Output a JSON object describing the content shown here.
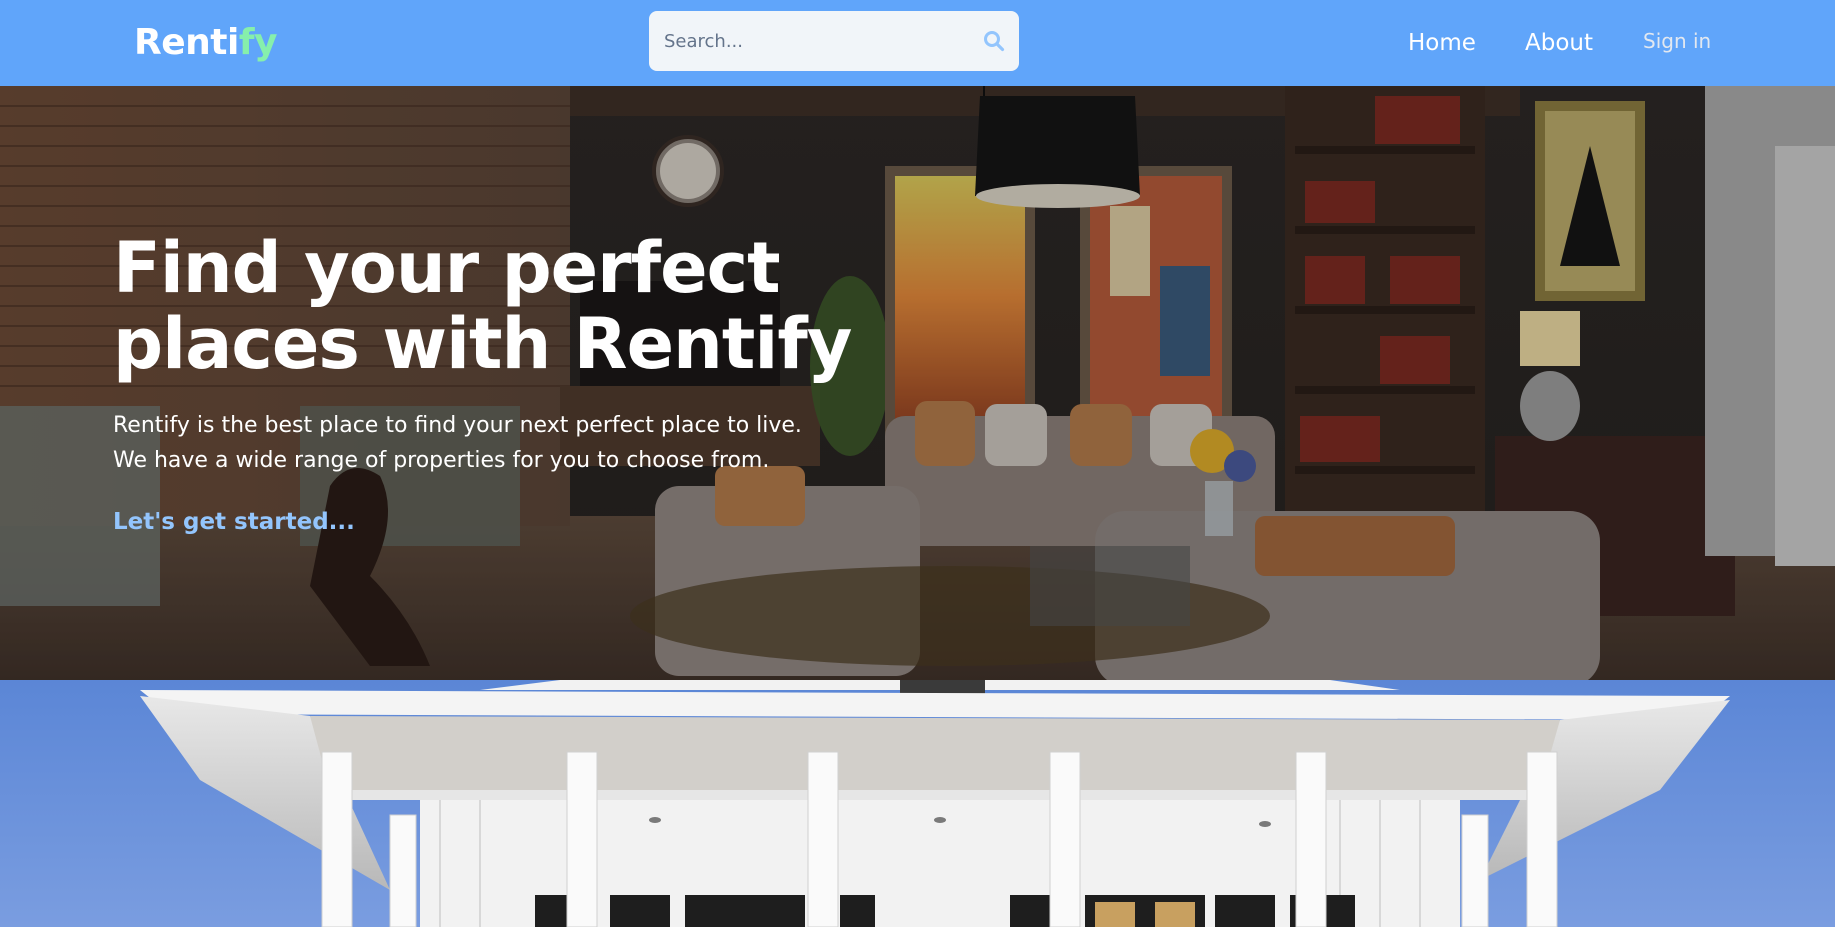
{
  "header": {
    "logo_main": "Renti",
    "logo_accent": "fy",
    "search": {
      "placeholder": "Search..."
    },
    "nav": {
      "home": "Home",
      "about": "About",
      "sign_in": "Sign in"
    }
  },
  "hero": {
    "title": "Find your perfect places with Rentify",
    "text_line1": "Rentify is the best place to find your next perfect place to live.",
    "text_line2": "We have a wide range of properties for you to choose from.",
    "cta": "Let's get started..."
  },
  "colors": {
    "header_bg": "#60a5fa",
    "logo_accent": "#86efac",
    "cta": "#93c5fd",
    "search_bg": "#f1f5f9"
  },
  "icons": {
    "search": "search-icon"
  }
}
